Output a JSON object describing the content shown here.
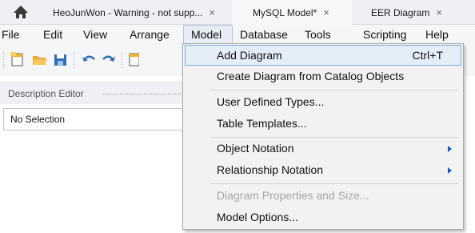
{
  "tabs": [
    {
      "label": "HeoJunWon - Warning - not supp...",
      "close": "×"
    },
    {
      "label": "MySQL Model*",
      "close": "×"
    },
    {
      "label": "EER Diagram",
      "close": "×"
    }
  ],
  "menubar": [
    "File",
    "Edit",
    "View",
    "Arrange",
    "Model",
    "Database",
    "Tools",
    "Scripting",
    "Help"
  ],
  "panel": {
    "title": "Description Editor",
    "selection": "No Selection"
  },
  "dropdown": {
    "add_diagram": {
      "label": "Add Diagram",
      "shortcut": "Ctrl+T"
    },
    "create_from_catalog": "Create Diagram from Catalog Objects",
    "user_defined_types": "User Defined Types...",
    "table_templates": "Table Templates...",
    "object_notation": "Object Notation",
    "relationship_notation": "Relationship Notation",
    "diagram_properties": "Diagram Properties and Size...",
    "model_options": "Model Options..."
  },
  "icons": [
    "home-icon",
    "new-model-icon",
    "open-model-icon",
    "save-model-icon",
    "undo-icon",
    "redo-icon",
    "new-diagram-icon"
  ],
  "colors": {
    "highlight": "#e3eef9",
    "highlight_border": "#7aa8d6",
    "submenu_arrow": "#1b5ab8",
    "disabled_text": "#a6a6a6"
  }
}
